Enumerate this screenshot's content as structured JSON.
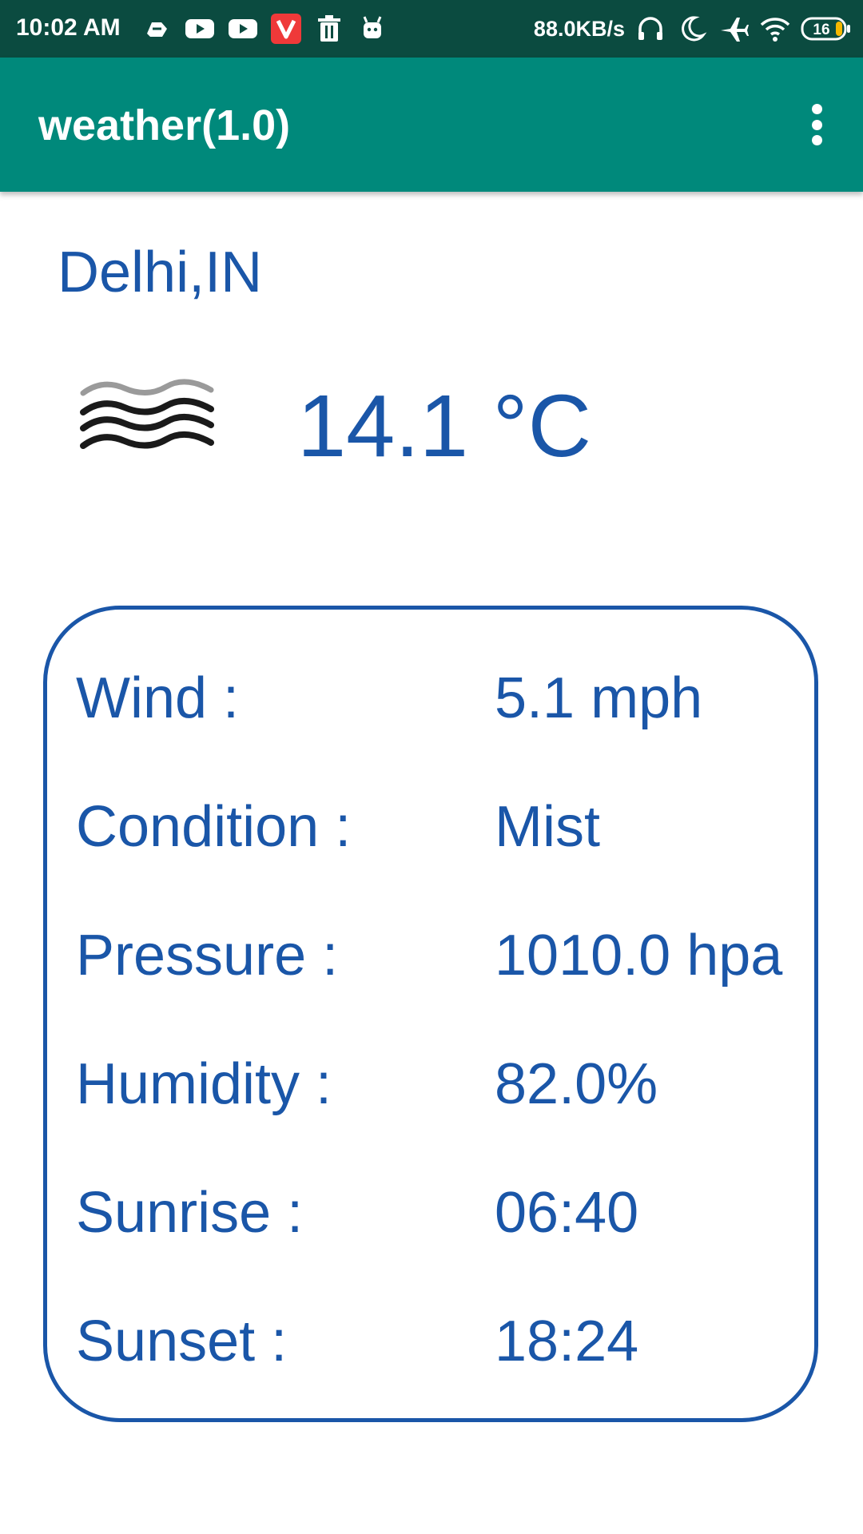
{
  "status_bar": {
    "time": "10:02 AM",
    "net_speed": "88.0KB/s",
    "battery_level": "16",
    "left_icons": [
      "cloud-icon",
      "youtube-icon",
      "youtube-icon",
      "vivaldi-icon",
      "trash-icon",
      "android-icon"
    ],
    "right_icons": [
      "headphones-icon",
      "moon-icon",
      "airplane-icon",
      "wifi-icon",
      "battery-icon"
    ]
  },
  "app_bar": {
    "title": "weather(1.0)",
    "menu_icon": "more-vert-icon",
    "color": "#00897b"
  },
  "weather": {
    "city": "Delhi,IN",
    "icon": "mist-icon",
    "temperature": "14.1 °C"
  },
  "details": [
    {
      "label": "Wind :",
      "value": "5.1 mph"
    },
    {
      "label": "Condition :",
      "value": "Mist"
    },
    {
      "label": "Pressure :",
      "value": "1010.0 hpa"
    },
    {
      "label": "Humidity :",
      "value": "82.0%"
    },
    {
      "label": "Sunrise :",
      "value": "06:40"
    },
    {
      "label": "Sunset :",
      "value": "18:24"
    }
  ],
  "colors": {
    "status_bar": "#0b4b40",
    "accent_text": "#1a56a8"
  }
}
